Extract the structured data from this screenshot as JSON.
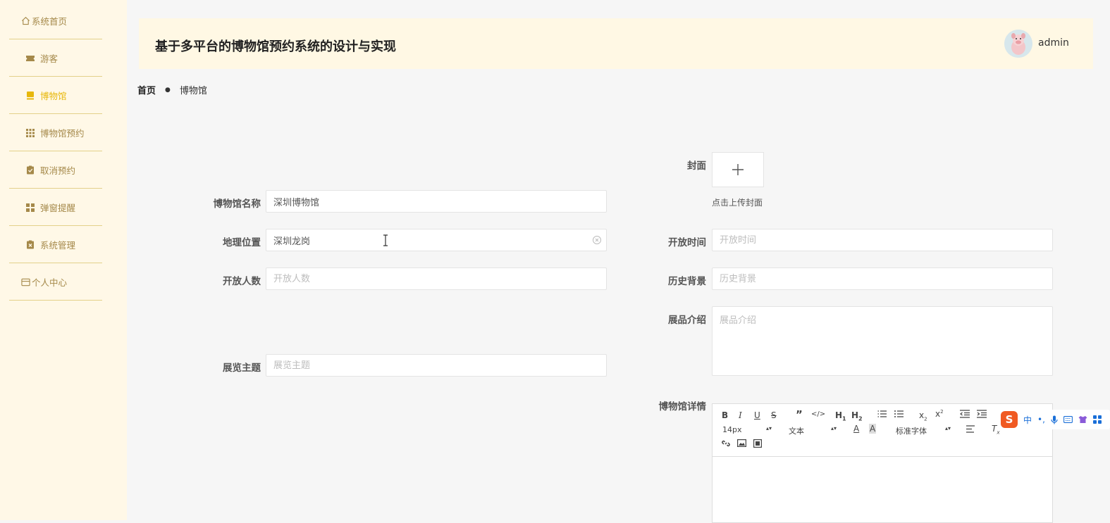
{
  "sidebar": {
    "items": [
      {
        "label": "系统首页",
        "icon": "home-icon"
      },
      {
        "label": "游客",
        "icon": "ticket-icon"
      },
      {
        "label": "博物馆",
        "icon": "museum-icon"
      },
      {
        "label": "博物馆预约",
        "icon": "grid-icon"
      },
      {
        "label": "取消预约",
        "icon": "clipboard-check-icon"
      },
      {
        "label": "弹窗提醒",
        "icon": "apps-icon"
      },
      {
        "label": "系统管理",
        "icon": "clipboard-x-icon"
      },
      {
        "label": "个人中心",
        "icon": "card-icon"
      }
    ],
    "active_index": 2
  },
  "header": {
    "title": "基于多平台的博物馆预约系统的设计与实现",
    "user": "admin"
  },
  "breadcrumb": {
    "home": "首页",
    "current": "博物馆"
  },
  "form": {
    "cover_label": "封面",
    "cover_hint": "点击上传封面",
    "name_label": "博物馆名称",
    "name_value": "深圳博物馆",
    "location_label": "地理位置",
    "location_value": "深圳龙岗",
    "open_time_label": "开放时间",
    "open_time_placeholder": "开放时间",
    "capacity_label": "开放人数",
    "capacity_placeholder": "开放人数",
    "history_label": "历史背景",
    "history_placeholder": "历史背景",
    "exhibits_label": "展品介绍",
    "exhibits_placeholder": "展品介绍",
    "theme_label": "展览主题",
    "theme_placeholder": "展览主题",
    "detail_label": "博物馆详情"
  },
  "editor": {
    "font_size": "14px",
    "format": "文本",
    "font_family": "标准字体"
  },
  "ime": {
    "lang": "中",
    "punct": "•,"
  },
  "colors": {
    "accent": "#e7b70a",
    "sidebar_bg": "#fff8e7",
    "header_bg": "#fff8e4",
    "divider": "#e3d08a"
  }
}
